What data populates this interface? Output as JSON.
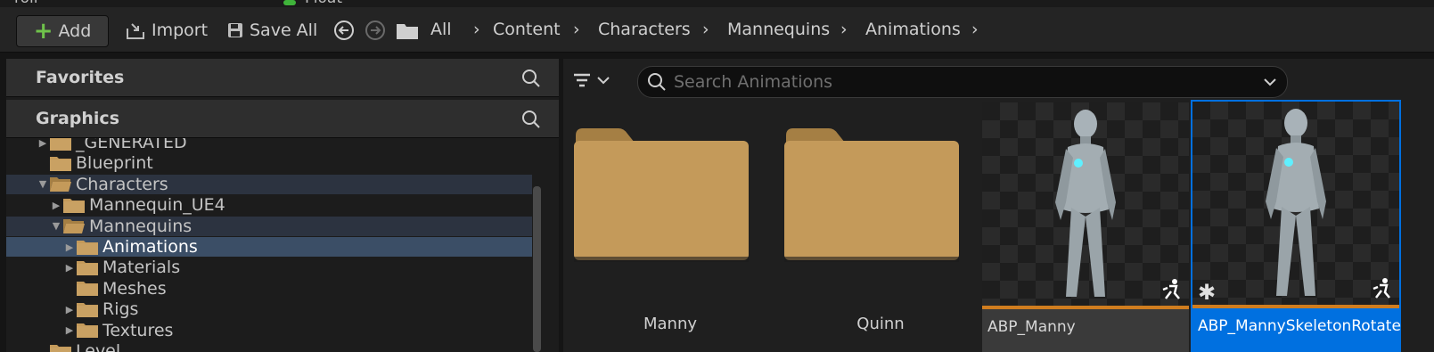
{
  "top_strip": {
    "left_text": "roll",
    "type_text": "Float"
  },
  "toolbar": {
    "add_label": "Add",
    "import_label": "Import",
    "save_all_label": "Save All",
    "breadcrumbs": [
      "All",
      "Content",
      "Characters",
      "Mannequins",
      "Animations"
    ]
  },
  "sources": {
    "favorites_label": "Favorites",
    "graphics_label": "Graphics",
    "tree": [
      {
        "label": "_GENERATED",
        "depth": 0,
        "expander": true,
        "state": ""
      },
      {
        "label": "Blueprint",
        "depth": 0,
        "expander": false,
        "state": ""
      },
      {
        "label": "Characters",
        "depth": 0,
        "expander": true,
        "open": true,
        "state": "dim"
      },
      {
        "label": "Mannequin_UE4",
        "depth": 1,
        "expander": true,
        "state": ""
      },
      {
        "label": "Mannequins",
        "depth": 1,
        "expander": true,
        "open": true,
        "state": "dim"
      },
      {
        "label": "Animations",
        "depth": 2,
        "expander": true,
        "state": "selected"
      },
      {
        "label": "Materials",
        "depth": 2,
        "expander": true,
        "state": ""
      },
      {
        "label": "Meshes",
        "depth": 2,
        "expander": false,
        "state": ""
      },
      {
        "label": "Rigs",
        "depth": 2,
        "expander": true,
        "state": ""
      },
      {
        "label": "Textures",
        "depth": 2,
        "expander": true,
        "state": ""
      },
      {
        "label": "Level",
        "depth": 0,
        "expander": false,
        "state": ""
      }
    ]
  },
  "content": {
    "search_placeholder": "Search Animations",
    "folders": [
      {
        "label": "Manny"
      },
      {
        "label": "Quinn"
      }
    ],
    "assets": [
      {
        "label": "ABP_Manny",
        "selected": false
      },
      {
        "label": "ABP_MannySkeletonRotate",
        "selected": true
      }
    ]
  },
  "colors": {
    "accent_selection": "#0070e0",
    "tree_selection": "#3b4e66",
    "folder": "#c49a5a",
    "anim_blueprint_bar": "#d07d1f",
    "add_plus": "#6fc24b"
  }
}
